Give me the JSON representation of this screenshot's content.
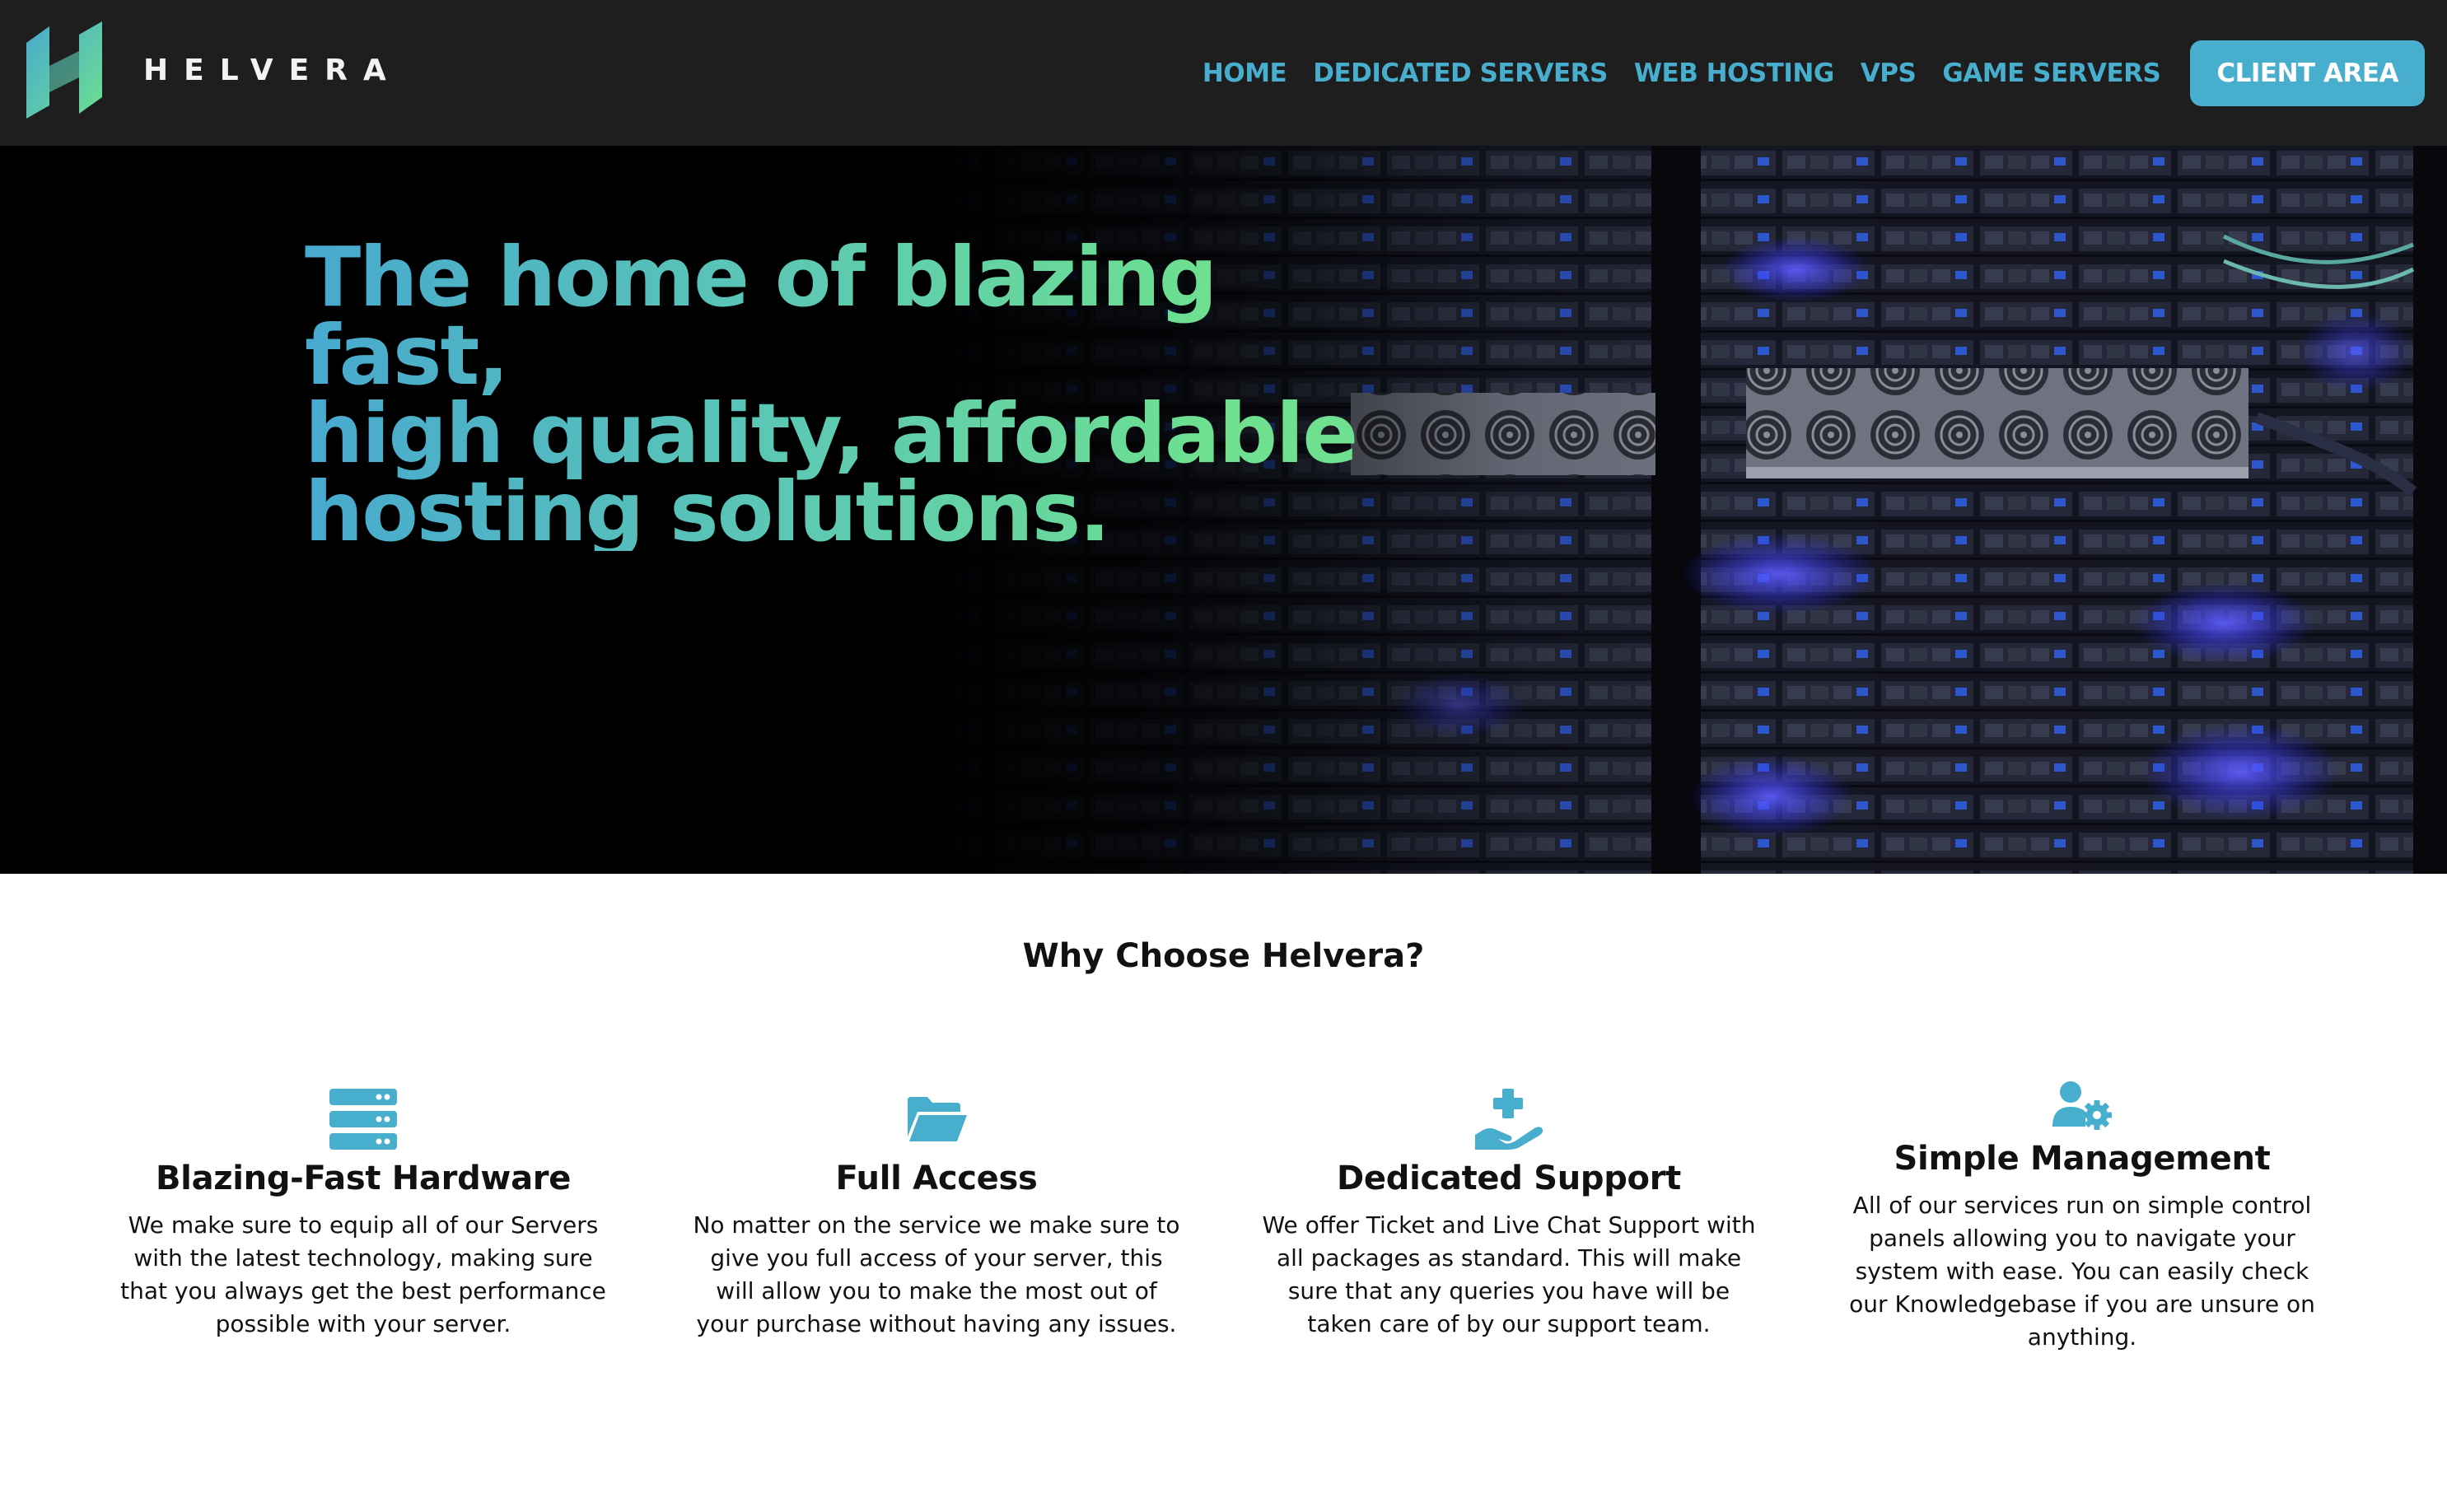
{
  "brand": {
    "name": "HELVERA",
    "accent": "#48aece",
    "gradient": [
      "#47a9cf",
      "#6ee08f"
    ]
  },
  "nav": {
    "links": [
      "HOME",
      "DEDICATED SERVERS",
      "WEB HOSTING",
      "VPS",
      "GAME SERVERS"
    ],
    "cta": "CLIENT AREA"
  },
  "hero": {
    "title_lines": [
      "The home of blazing fast,",
      "high quality, affordable",
      "hosting solutions."
    ]
  },
  "features": {
    "title": "Why Choose Helvera?",
    "items": [
      {
        "icon": "server-stack-icon",
        "title": "Blazing-Fast Hardware",
        "desc": "We make sure to equip all of our Servers with the latest technology, making sure that you always get the best performance possible with your server."
      },
      {
        "icon": "folder-open-icon",
        "title": "Full Access",
        "desc": "No matter on the service we make sure to give you full access of your server, this will allow you to make the most out of your purchase without having any issues."
      },
      {
        "icon": "hand-plus-icon",
        "title": "Dedicated Support",
        "desc": "We offer Ticket and Live Chat Support with all packages as standard. This will make sure that any queries you have will be taken care of by our support team."
      },
      {
        "icon": "user-gear-icon",
        "title": "Simple Management",
        "desc": "All of our services run on simple control panels allowing you to navigate your system with ease. You can easily check our Knowledgebase if you are unsure on anything."
      }
    ]
  }
}
